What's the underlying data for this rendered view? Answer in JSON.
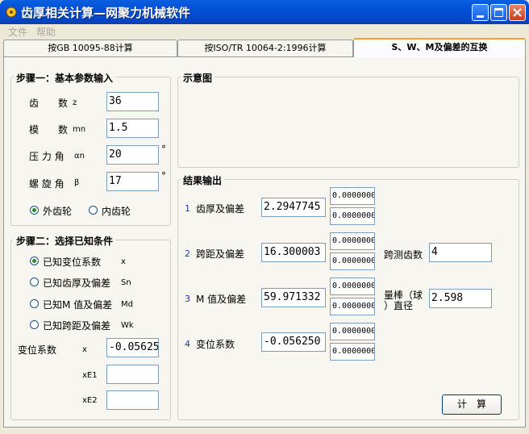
{
  "window": {
    "title": "齿厚相关计算—网聚力机械软件"
  },
  "menu": {
    "file": "文件",
    "help": "帮助"
  },
  "tabs": [
    {
      "label": "按GB 10095-88计算"
    },
    {
      "label": "按ISO/TR 10064-2:1996计算"
    },
    {
      "label": "S、W、M及偏差的互换"
    }
  ],
  "step1": {
    "title": "步骤一：基本参数输入",
    "teeth_label": "齿　　数",
    "teeth_symbol": "z",
    "teeth_value": "36",
    "module_label": "模　　数",
    "module_symbol": "mn",
    "module_value": "1.5",
    "pressure_label": "压 力 角",
    "pressure_symbol": "αn",
    "pressure_value": "20",
    "helix_label": "螺 旋 角",
    "helix_symbol": "β",
    "helix_value": "17",
    "degree": "°",
    "external_gear": "外齿轮",
    "internal_gear": "内齿轮"
  },
  "step2": {
    "title": "步骤二：选择已知条件",
    "opt1_label": "已知变位系数",
    "opt1_symbol": "x",
    "opt2_label": "已知齿厚及偏差",
    "opt2_symbol": "Sn",
    "opt3_label": "已知M 值及偏差",
    "opt3_symbol": "Md",
    "opt4_label": "已知跨距及偏差",
    "opt4_symbol": "Wk",
    "shift_label": "变位系数",
    "shift_symbol": "x",
    "shift_value": "-0.05625",
    "xe1_label": "xE1",
    "xe1_value": "",
    "xe2_label": "xE2",
    "xe2_value": ""
  },
  "diagram": {
    "title": "示意图"
  },
  "results": {
    "title": "结果输出",
    "r1_num": "1",
    "r1_label": "齿厚及偏差",
    "r1_value": "2.2947745",
    "r1_dev_upper": "0.0000000",
    "r1_dev_lower": "0.0000000",
    "r2_num": "2",
    "r2_label": "跨距及偏差",
    "r2_value": "16.300003",
    "r2_dev_upper": "0.0000000",
    "r2_dev_lower": "0.0000000",
    "span_teeth_label": "跨测齿数",
    "span_teeth_value": "4",
    "r3_num": "3",
    "r3_label": "M 值及偏差",
    "r3_value": "59.971332",
    "r3_dev_upper": "0.0000000",
    "r3_dev_lower": "0.0000000",
    "ball_label_line1": "量棒（球",
    "ball_label_line2": "）直径",
    "ball_value": "2.598",
    "r4_num": "4",
    "r4_label": "变位系数",
    "r4_value": "-0.056250",
    "r4_dev_upper": "0.0000000",
    "r4_dev_lower": "0.0000000",
    "calc_button": "计　算"
  }
}
